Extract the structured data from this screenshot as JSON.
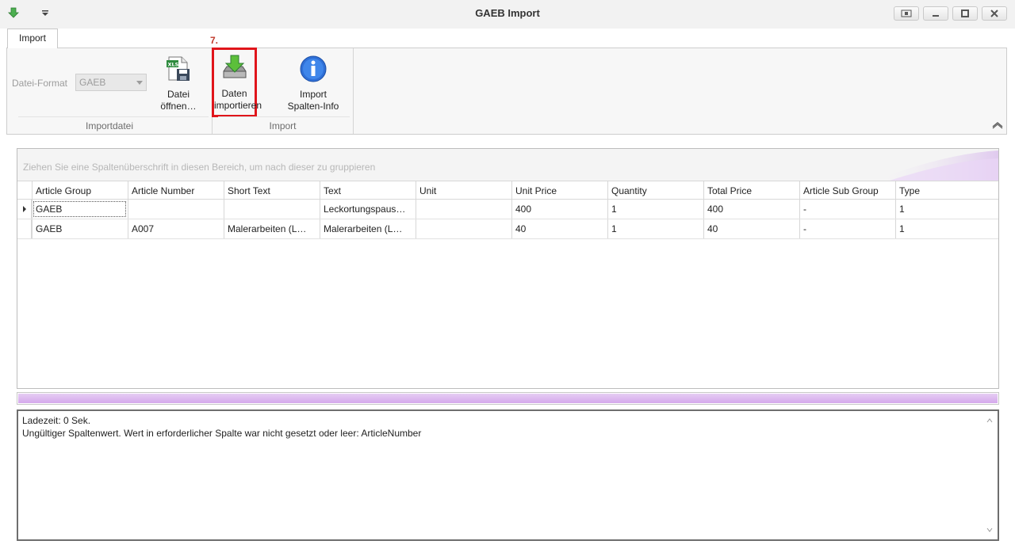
{
  "window": {
    "title": "GAEB Import"
  },
  "ribbon": {
    "tab_label": "Import",
    "format_label": "Datei-Format",
    "format_value": "GAEB",
    "open_file_label": "Datei\nöffnen…",
    "import_data_label": "Daten\nimportieren",
    "column_info_label": "Import\nSpalten-Info",
    "group1_caption": "Importdatei",
    "group2_caption": "Import",
    "step_label": "7."
  },
  "grid": {
    "group_panel_text": "Ziehen Sie eine Spaltenüberschrift in diesen Bereich, um nach dieser zu gruppieren",
    "columns": [
      "Article Group",
      "Article Number",
      "Short Text",
      "Text",
      "Unit",
      "Unit Price",
      "Quantity",
      "Total Price",
      "Article Sub Group",
      "Type"
    ],
    "rows": [
      [
        "GAEB",
        "",
        "",
        "Leckortungspaus…",
        "",
        "400",
        "1",
        "400",
        "-",
        "1"
      ],
      [
        "GAEB",
        "A007",
        "Malerarbeiten (L…",
        "Malerarbeiten (L…",
        "",
        "40",
        "1",
        "40",
        "-",
        "1"
      ]
    ]
  },
  "progress": {
    "percent": 100
  },
  "log": {
    "line1": "Ladezeit: 0 Sek.",
    "line2": "Ungültiger Spaltenwert. Wert in erforderlicher Spalte war nicht gesetzt oder leer: ArticleNumber"
  },
  "colors": {
    "accent": "#d4a8ec",
    "highlight": "#e0151b"
  },
  "icons": {
    "app": "download-arrow-icon",
    "qat": "customize-dropdown-icon",
    "open_file": "xls-save-icon",
    "import": "download-tray-icon",
    "info": "info-icon"
  }
}
